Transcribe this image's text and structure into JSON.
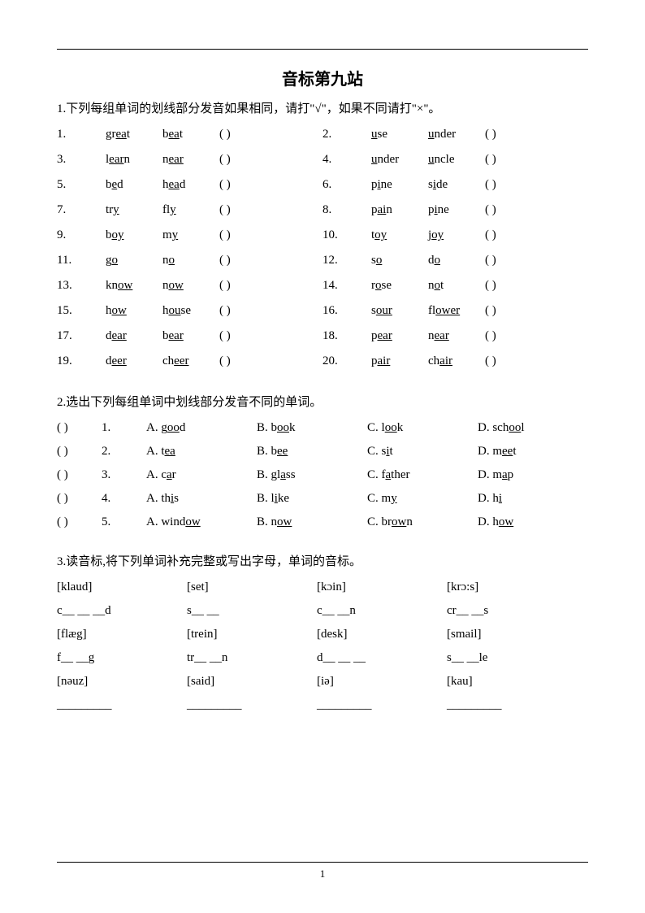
{
  "title": "音标第九站",
  "section1": {
    "instruction": "1.下列每组单词的划线部分发音如果相同，请打\"√\"，如果不同请打\"×\"。",
    "rows": [
      {
        "l": {
          "n": "1.",
          "w1p": "gr",
          "w1u": "ea",
          "w1s": "t",
          "w2p": "b",
          "w2u": "ea",
          "w2s": "t"
        },
        "r": {
          "n": "2.",
          "w1p": "",
          "w1u": "u",
          "w1s": "se",
          "w2p": "",
          "w2u": "u",
          "w2s": "nder"
        }
      },
      {
        "l": {
          "n": "3.",
          "w1p": "l",
          "w1u": "ear",
          "w1s": "n",
          "w2p": "n",
          "w2u": "ear",
          "w2s": ""
        },
        "r": {
          "n": "4.",
          "w1p": "",
          "w1u": "u",
          "w1s": "nder",
          "w2p": "",
          "w2u": "u",
          "w2s": "ncle"
        }
      },
      {
        "l": {
          "n": "5.",
          "w1p": "b",
          "w1u": "e",
          "w1s": "d",
          "w2p": "h",
          "w2u": "ea",
          "w2s": "d"
        },
        "r": {
          "n": "6.",
          "w1p": "p",
          "w1u": "i",
          "w1s": "ne",
          "w2p": "s",
          "w2u": "i",
          "w2s": "de"
        }
      },
      {
        "l": {
          "n": "7.",
          "w1p": "tr",
          "w1u": "y",
          "w1s": "",
          "w2p": "fl",
          "w2u": "y",
          "w2s": ""
        },
        "r": {
          "n": "8.",
          "w1p": "p",
          "w1u": "ai",
          "w1s": "n",
          "w2p": "p",
          "w2u": "i",
          "w2s": "ne"
        }
      },
      {
        "l": {
          "n": "9.",
          "w1p": "b",
          "w1u": "oy",
          "w1s": "",
          "w2p": "m",
          "w2u": "y",
          "w2s": ""
        },
        "r": {
          "n": "10.",
          "w1p": "t",
          "w1u": "oy",
          "w1s": "",
          "w2p": "j",
          "w2u": "oy",
          "w2s": ""
        }
      },
      {
        "l": {
          "n": "11.",
          "w1p": "g",
          "w1u": "o",
          "w1s": "",
          "w2p": "n",
          "w2u": "o",
          "w2s": ""
        },
        "r": {
          "n": "12.",
          "w1p": "s",
          "w1u": "o",
          "w1s": "",
          "w2p": "d",
          "w2u": "o",
          "w2s": ""
        }
      },
      {
        "l": {
          "n": "13.",
          "w1p": "kn",
          "w1u": "ow",
          "w1s": "",
          "w2p": "n",
          "w2u": "ow",
          "w2s": ""
        },
        "r": {
          "n": "14.",
          "w1p": "r",
          "w1u": "o",
          "w1s": "se",
          "w2p": "n",
          "w2u": "o",
          "w2s": "t"
        }
      },
      {
        "l": {
          "n": "15.",
          "w1p": "h",
          "w1u": "ow",
          "w1s": "",
          "w2p": "h",
          "w2u": "ou",
          "w2s": "se"
        },
        "r": {
          "n": "16.",
          "w1p": "s",
          "w1u": "our",
          "w1s": "",
          "w2p": "fl",
          "w2u": "ower",
          "w2s": ""
        }
      },
      {
        "l": {
          "n": "17.",
          "w1p": "d",
          "w1u": "ear",
          "w1s": "",
          "w2p": "b",
          "w2u": "ear",
          "w2s": ""
        },
        "r": {
          "n": "18.",
          "w1p": "p",
          "w1u": "ear",
          "w1s": "",
          "w2p": "n",
          "w2u": "ear",
          "w2s": ""
        }
      },
      {
        "l": {
          "n": "19.",
          "w1p": "d",
          "w1u": "eer",
          "w1s": "",
          "w2p": "ch",
          "w2u": "eer",
          "w2s": ""
        },
        "r": {
          "n": "20.",
          "w1p": "p",
          "w1u": "air",
          "w1s": "",
          "w2p": "ch",
          "w2u": "air",
          "w2s": ""
        }
      }
    ],
    "paren": "(      )"
  },
  "section2": {
    "instruction": "2.选出下列每组单词中划线部分发音不同的单词。",
    "paren": "(       )",
    "rows": [
      {
        "n": "1.",
        "a": {
          "l": "A. g",
          "u": "oo",
          "s": "d"
        },
        "b": {
          "l": "B. b",
          "u": "oo",
          "s": "k"
        },
        "c": {
          "l": "C. l",
          "u": "oo",
          "s": "k"
        },
        "d": {
          "l": "D. sch",
          "u": "oo",
          "s": "l"
        }
      },
      {
        "n": "2.",
        "a": {
          "l": "A. t",
          "u": "ea",
          "s": ""
        },
        "b": {
          "l": "B. b",
          "u": "ee",
          "s": ""
        },
        "c": {
          "l": "C. s",
          "u": "i",
          "s": "t"
        },
        "d": {
          "l": "D. m",
          "u": "ee",
          "s": "t"
        }
      },
      {
        "n": "3.",
        "a": {
          "l": "A. c",
          "u": "a",
          "s": "r"
        },
        "b": {
          "l": "B. gl",
          "u": "a",
          "s": "ss"
        },
        "c": {
          "l": "C. f",
          "u": "a",
          "s": "ther"
        },
        "d": {
          "l": "D. m",
          "u": "a",
          "s": "p"
        }
      },
      {
        "n": "4.",
        "a": {
          "l": "A. th",
          "u": "i",
          "s": "s"
        },
        "b": {
          "l": "B. l",
          "u": "i",
          "s": "ke"
        },
        "c": {
          "l": "C. m",
          "u": "y",
          "s": ""
        },
        "d": {
          "l": "D. h",
          "u": "i",
          "s": ""
        }
      },
      {
        "n": "5.",
        "a": {
          "l": "A. wind",
          "u": "ow",
          "s": ""
        },
        "b": {
          "l": "B. n",
          "u": "ow",
          "s": ""
        },
        "c": {
          "l": "C. br",
          "u": "ow",
          "s": "n"
        },
        "d": {
          "l": "D. h",
          "u": "ow",
          "s": ""
        }
      }
    ]
  },
  "section3": {
    "instruction": "3.读音标,将下列单词补充完整或写出字母，单词的音标。",
    "rows": [
      [
        "[klaud]",
        "[set]",
        "[kɔin]",
        "[krɔ:s]"
      ],
      [
        "c__ __ __d",
        "s__ __",
        "c__ __n",
        "cr__ __s"
      ],
      [
        "[flæg]",
        "[trein]",
        "[desk]",
        "[smail]"
      ],
      [
        "f__ __g",
        "tr__ __n",
        "d__ __ __",
        "s__ __le"
      ],
      [
        "  [nəuz]",
        "[said]",
        "[iə]",
        "[kau]"
      ],
      [
        "_________",
        "_________",
        "_________",
        "_________"
      ]
    ]
  },
  "pageNum": "1"
}
